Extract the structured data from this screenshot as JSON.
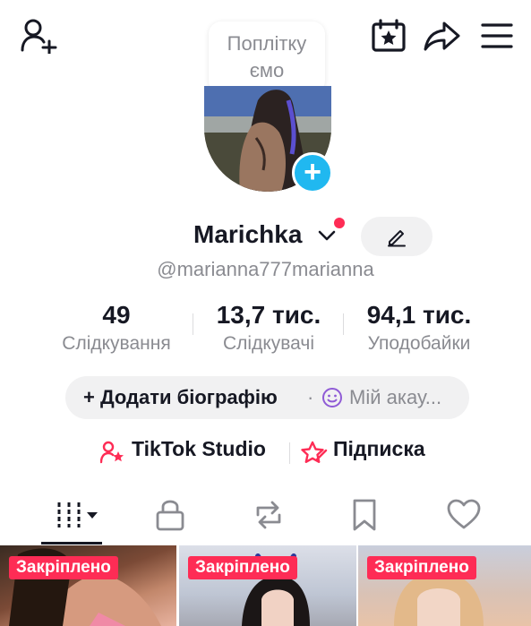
{
  "header": {
    "tooltip_line1": "Поплітку",
    "tooltip_line2": "ємо"
  },
  "profile": {
    "name": "Marichka",
    "handle": "@marianna777marianna"
  },
  "stats": [
    {
      "value": "49",
      "label": "Слідкування"
    },
    {
      "value": "13,7 тис.",
      "label": "Слідкувачі"
    },
    {
      "value": "94,1 тис.",
      "label": "Уподобайки"
    }
  ],
  "bio": {
    "add_label": "+ Додати біографію",
    "separator": "·",
    "account_label": "Мій акау..."
  },
  "links": {
    "studio_label": "TikTok Studio",
    "subscription_label": "Підписка"
  },
  "grid": [
    {
      "badge": "Закріплено"
    },
    {
      "badge": "Закріплено"
    },
    {
      "badge": "Закріплено"
    }
  ],
  "colors": {
    "accent": "#fe2c55",
    "badge_blue": "#20b8f0",
    "muted": "#8a8b91"
  }
}
